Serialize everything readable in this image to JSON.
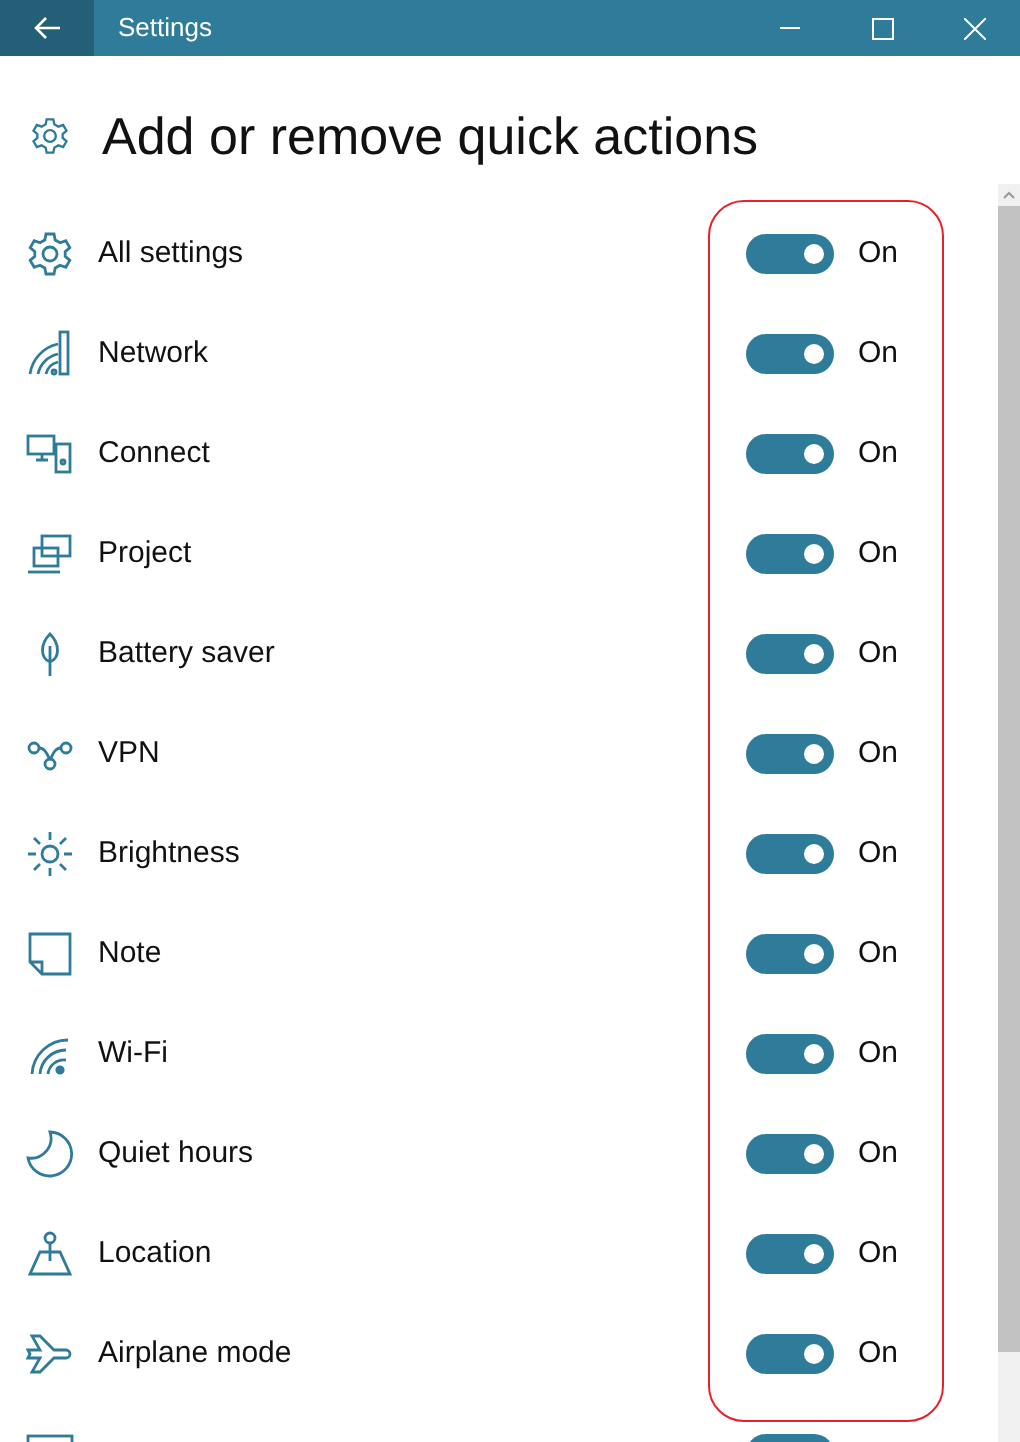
{
  "window": {
    "title": "Settings"
  },
  "page": {
    "heading": "Add or remove quick actions"
  },
  "actions": [
    {
      "label": "All settings",
      "on": true,
      "state_label": "On"
    },
    {
      "label": "Network",
      "on": true,
      "state_label": "On"
    },
    {
      "label": "Connect",
      "on": true,
      "state_label": "On"
    },
    {
      "label": "Project",
      "on": true,
      "state_label": "On"
    },
    {
      "label": "Battery saver",
      "on": true,
      "state_label": "On"
    },
    {
      "label": "VPN",
      "on": true,
      "state_label": "On"
    },
    {
      "label": "Brightness",
      "on": true,
      "state_label": "On"
    },
    {
      "label": "Note",
      "on": true,
      "state_label": "On"
    },
    {
      "label": "Wi-Fi",
      "on": true,
      "state_label": "On"
    },
    {
      "label": "Quiet hours",
      "on": true,
      "state_label": "On"
    },
    {
      "label": "Location",
      "on": true,
      "state_label": "On"
    },
    {
      "label": "Airplane mode",
      "on": true,
      "state_label": "On"
    },
    {
      "on": true
    }
  ]
}
